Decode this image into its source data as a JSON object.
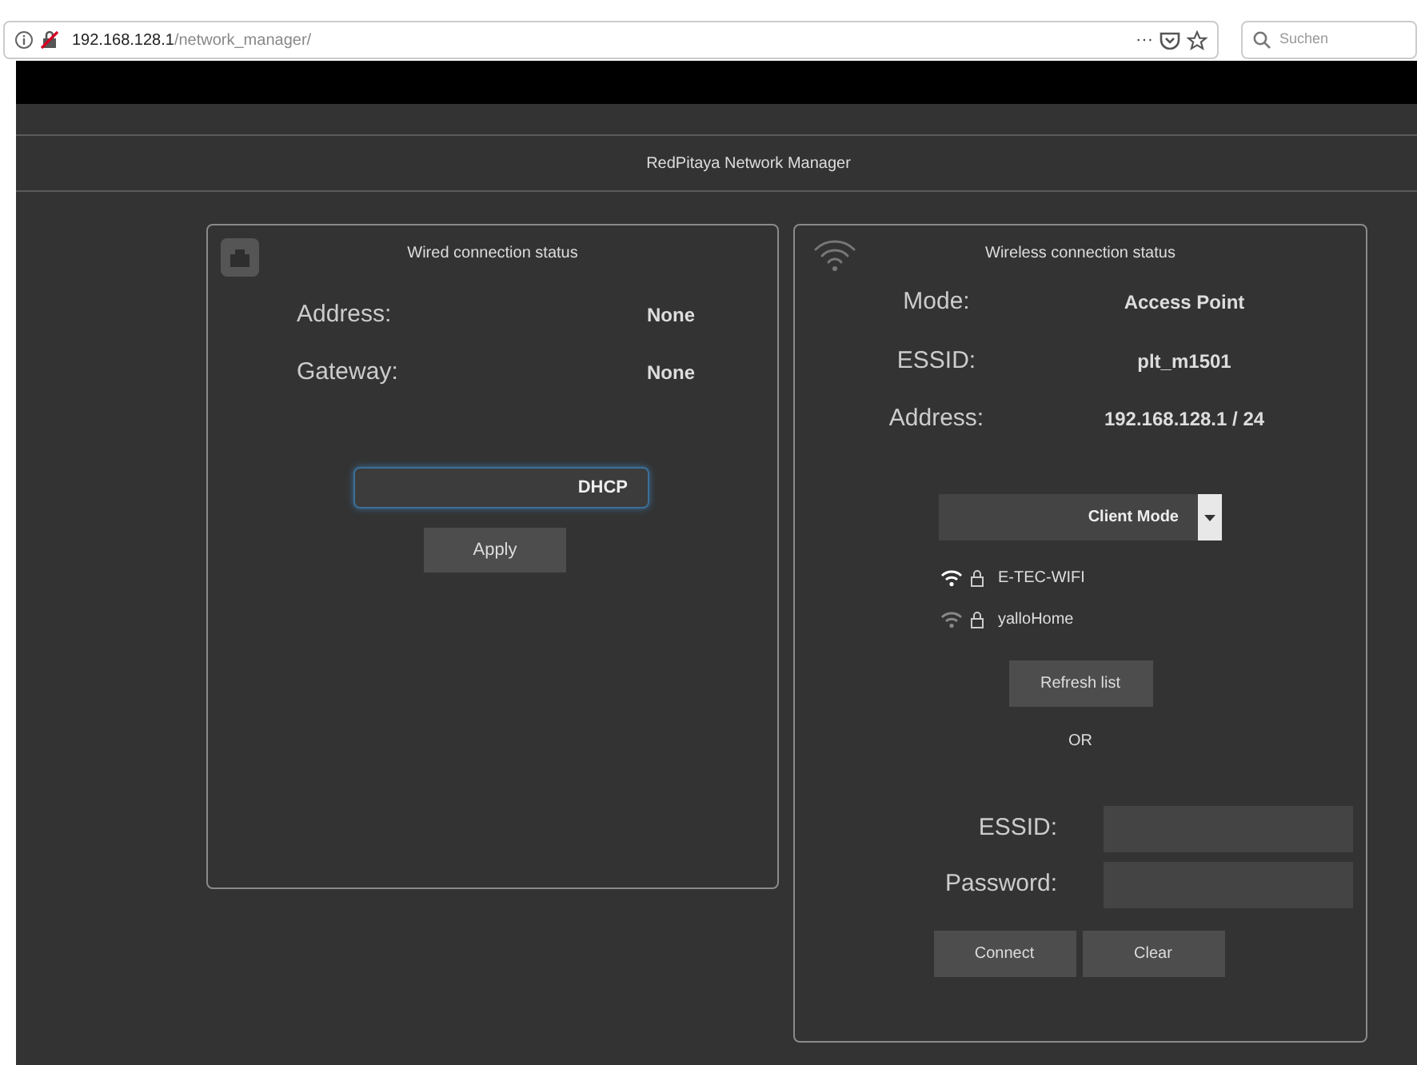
{
  "browser": {
    "url_host": "192.168.128.1",
    "url_path": "/network_manager/",
    "search_placeholder": "Suchen",
    "menu_glyph": "···"
  },
  "page_title": "RedPitaya Network Manager",
  "wired": {
    "title": "Wired connection status",
    "fields": [
      {
        "label": "Address:",
        "value": "None"
      },
      {
        "label": "Gateway:",
        "value": "None"
      }
    ],
    "mode_select": {
      "value": "DHCP",
      "focused": true
    },
    "apply_button": "Apply"
  },
  "wireless": {
    "title": "Wireless connection status",
    "fields": [
      {
        "label": "Mode:",
        "value": "Access Point"
      },
      {
        "label": "ESSID:",
        "value": "plt_m1501"
      },
      {
        "label": "Address:",
        "value": "192.168.128.1 / 24"
      }
    ],
    "mode_select": {
      "value": "Client Mode"
    },
    "networks": [
      {
        "name": "E-TEC-WIFI",
        "strong": true,
        "locked": true
      },
      {
        "name": "yalloHome",
        "strong": false,
        "locked": true
      }
    ],
    "refresh_button": "Refresh list",
    "or_text": "OR",
    "inputs": [
      {
        "label": "ESSID:"
      },
      {
        "label": "Password:"
      }
    ],
    "buttons": [
      "Connect",
      "Clear"
    ]
  }
}
